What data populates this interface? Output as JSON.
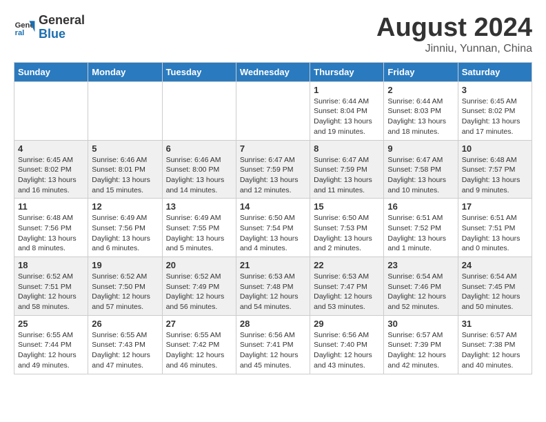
{
  "header": {
    "logo_line1": "General",
    "logo_line2": "Blue",
    "main_title": "August 2024",
    "subtitle": "Jinniu, Yunnan, China"
  },
  "columns": [
    "Sunday",
    "Monday",
    "Tuesday",
    "Wednesday",
    "Thursday",
    "Friday",
    "Saturday"
  ],
  "weeks": [
    [
      {
        "day": "",
        "info": ""
      },
      {
        "day": "",
        "info": ""
      },
      {
        "day": "",
        "info": ""
      },
      {
        "day": "",
        "info": ""
      },
      {
        "day": "1",
        "info": "Sunrise: 6:44 AM\nSunset: 8:04 PM\nDaylight: 13 hours\nand 19 minutes."
      },
      {
        "day": "2",
        "info": "Sunrise: 6:44 AM\nSunset: 8:03 PM\nDaylight: 13 hours\nand 18 minutes."
      },
      {
        "day": "3",
        "info": "Sunrise: 6:45 AM\nSunset: 8:02 PM\nDaylight: 13 hours\nand 17 minutes."
      }
    ],
    [
      {
        "day": "4",
        "info": "Sunrise: 6:45 AM\nSunset: 8:02 PM\nDaylight: 13 hours\nand 16 minutes."
      },
      {
        "day": "5",
        "info": "Sunrise: 6:46 AM\nSunset: 8:01 PM\nDaylight: 13 hours\nand 15 minutes."
      },
      {
        "day": "6",
        "info": "Sunrise: 6:46 AM\nSunset: 8:00 PM\nDaylight: 13 hours\nand 14 minutes."
      },
      {
        "day": "7",
        "info": "Sunrise: 6:47 AM\nSunset: 7:59 PM\nDaylight: 13 hours\nand 12 minutes."
      },
      {
        "day": "8",
        "info": "Sunrise: 6:47 AM\nSunset: 7:59 PM\nDaylight: 13 hours\nand 11 minutes."
      },
      {
        "day": "9",
        "info": "Sunrise: 6:47 AM\nSunset: 7:58 PM\nDaylight: 13 hours\nand 10 minutes."
      },
      {
        "day": "10",
        "info": "Sunrise: 6:48 AM\nSunset: 7:57 PM\nDaylight: 13 hours\nand 9 minutes."
      }
    ],
    [
      {
        "day": "11",
        "info": "Sunrise: 6:48 AM\nSunset: 7:56 PM\nDaylight: 13 hours\nand 8 minutes."
      },
      {
        "day": "12",
        "info": "Sunrise: 6:49 AM\nSunset: 7:56 PM\nDaylight: 13 hours\nand 6 minutes."
      },
      {
        "day": "13",
        "info": "Sunrise: 6:49 AM\nSunset: 7:55 PM\nDaylight: 13 hours\nand 5 minutes."
      },
      {
        "day": "14",
        "info": "Sunrise: 6:50 AM\nSunset: 7:54 PM\nDaylight: 13 hours\nand 4 minutes."
      },
      {
        "day": "15",
        "info": "Sunrise: 6:50 AM\nSunset: 7:53 PM\nDaylight: 13 hours\nand 2 minutes."
      },
      {
        "day": "16",
        "info": "Sunrise: 6:51 AM\nSunset: 7:52 PM\nDaylight: 13 hours\nand 1 minute."
      },
      {
        "day": "17",
        "info": "Sunrise: 6:51 AM\nSunset: 7:51 PM\nDaylight: 13 hours\nand 0 minutes."
      }
    ],
    [
      {
        "day": "18",
        "info": "Sunrise: 6:52 AM\nSunset: 7:51 PM\nDaylight: 12 hours\nand 58 minutes."
      },
      {
        "day": "19",
        "info": "Sunrise: 6:52 AM\nSunset: 7:50 PM\nDaylight: 12 hours\nand 57 minutes."
      },
      {
        "day": "20",
        "info": "Sunrise: 6:52 AM\nSunset: 7:49 PM\nDaylight: 12 hours\nand 56 minutes."
      },
      {
        "day": "21",
        "info": "Sunrise: 6:53 AM\nSunset: 7:48 PM\nDaylight: 12 hours\nand 54 minutes."
      },
      {
        "day": "22",
        "info": "Sunrise: 6:53 AM\nSunset: 7:47 PM\nDaylight: 12 hours\nand 53 minutes."
      },
      {
        "day": "23",
        "info": "Sunrise: 6:54 AM\nSunset: 7:46 PM\nDaylight: 12 hours\nand 52 minutes."
      },
      {
        "day": "24",
        "info": "Sunrise: 6:54 AM\nSunset: 7:45 PM\nDaylight: 12 hours\nand 50 minutes."
      }
    ],
    [
      {
        "day": "25",
        "info": "Sunrise: 6:55 AM\nSunset: 7:44 PM\nDaylight: 12 hours\nand 49 minutes."
      },
      {
        "day": "26",
        "info": "Sunrise: 6:55 AM\nSunset: 7:43 PM\nDaylight: 12 hours\nand 47 minutes."
      },
      {
        "day": "27",
        "info": "Sunrise: 6:55 AM\nSunset: 7:42 PM\nDaylight: 12 hours\nand 46 minutes."
      },
      {
        "day": "28",
        "info": "Sunrise: 6:56 AM\nSunset: 7:41 PM\nDaylight: 12 hours\nand 45 minutes."
      },
      {
        "day": "29",
        "info": "Sunrise: 6:56 AM\nSunset: 7:40 PM\nDaylight: 12 hours\nand 43 minutes."
      },
      {
        "day": "30",
        "info": "Sunrise: 6:57 AM\nSunset: 7:39 PM\nDaylight: 12 hours\nand 42 minutes."
      },
      {
        "day": "31",
        "info": "Sunrise: 6:57 AM\nSunset: 7:38 PM\nDaylight: 12 hours\nand 40 minutes."
      }
    ]
  ]
}
